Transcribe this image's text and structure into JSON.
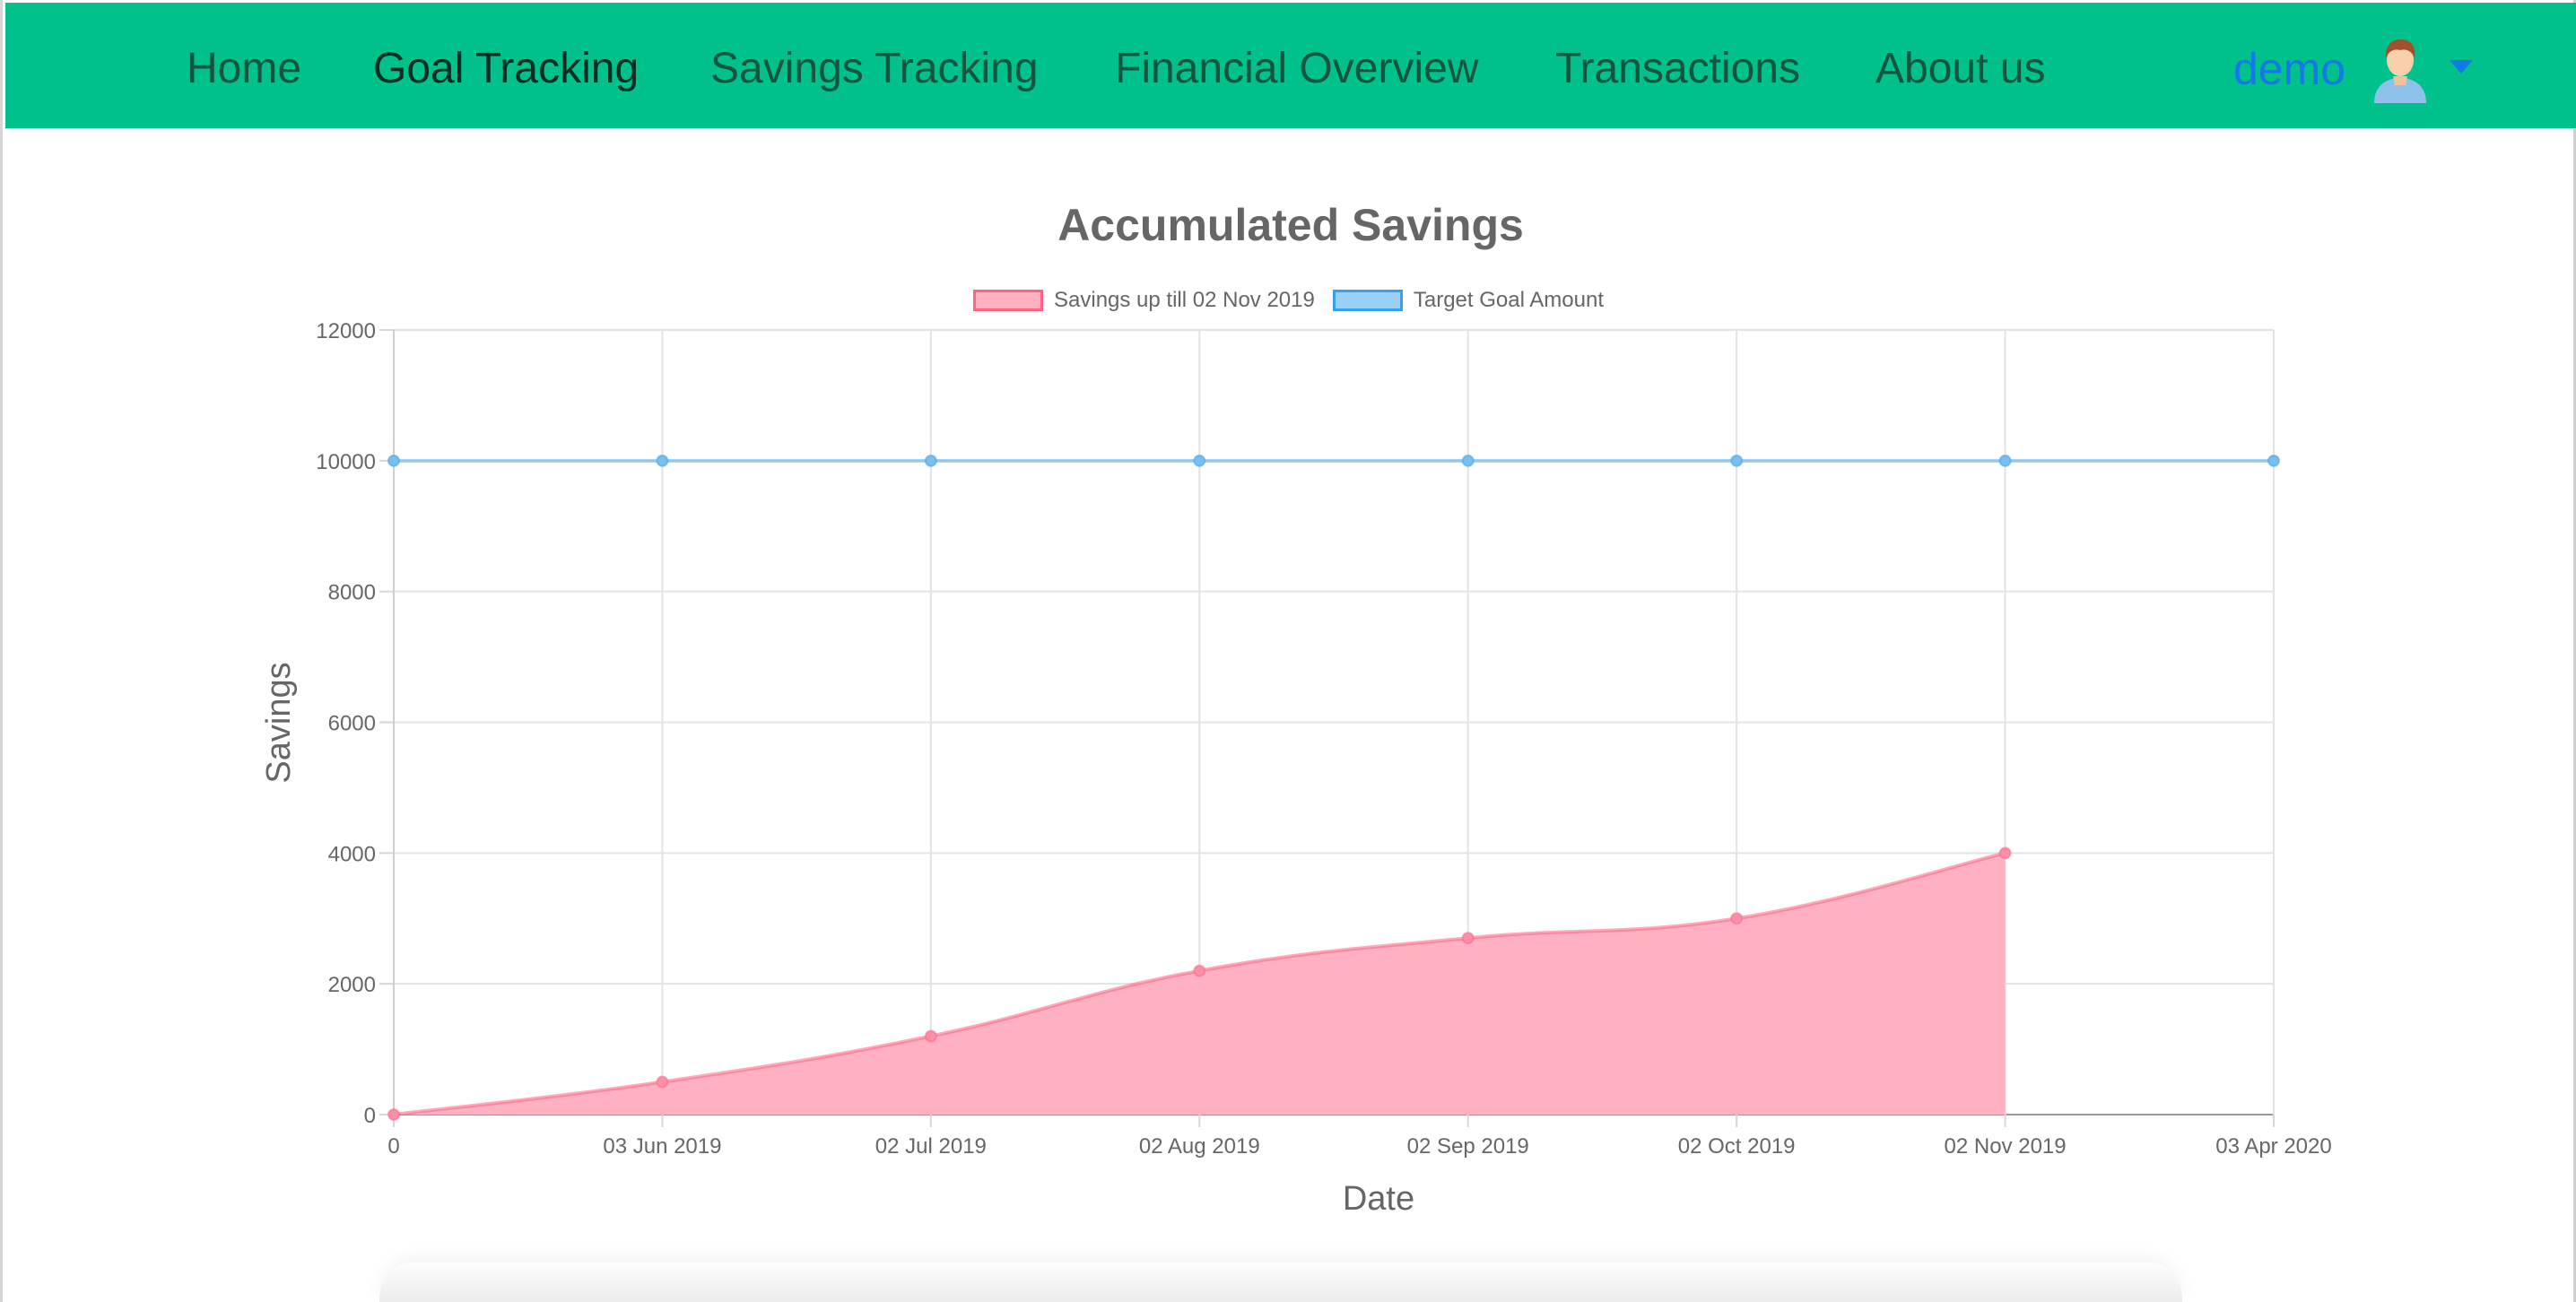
{
  "navbar": {
    "items": [
      {
        "label": "Home",
        "active": false
      },
      {
        "label": "Goal Tracking",
        "active": true
      },
      {
        "label": "Savings Tracking",
        "active": false
      },
      {
        "label": "Financial Overview",
        "active": false
      },
      {
        "label": "Transactions",
        "active": false
      },
      {
        "label": "About us",
        "active": false
      }
    ],
    "user": {
      "name": "demo",
      "avatar_icon": "user-avatar-icon",
      "menu_icon": "caret-down-icon"
    }
  },
  "colors": {
    "navbar_bg": "#00c08b",
    "savings_fill": "#ffb1c1",
    "savings_line": "#ff6384",
    "target_fill": "#9ad0f5",
    "target_line": "#36a2eb",
    "user_link": "#1479e6"
  },
  "chart_data": {
    "type": "line",
    "title": "Accumulated Savings",
    "xlabel": "Date",
    "ylabel": "Savings",
    "ylim": [
      0,
      12000
    ],
    "yticks": [
      0,
      2000,
      4000,
      6000,
      8000,
      10000,
      12000
    ],
    "categories": [
      "0",
      "03 Jun 2019",
      "02 Jul 2019",
      "02 Aug 2019",
      "02 Sep 2019",
      "02 Oct 2019",
      "02 Nov 2019",
      "03 Apr 2020"
    ],
    "series": [
      {
        "name": "Savings up till 02 Nov 2019",
        "values": [
          0,
          500,
          1200,
          2200,
          2700,
          3000,
          4000,
          null
        ],
        "fill": true
      },
      {
        "name": "Target Goal Amount",
        "values": [
          10000,
          10000,
          10000,
          10000,
          10000,
          10000,
          10000,
          10000
        ],
        "fill": false
      }
    ],
    "grid": true,
    "legend_position": "top"
  }
}
